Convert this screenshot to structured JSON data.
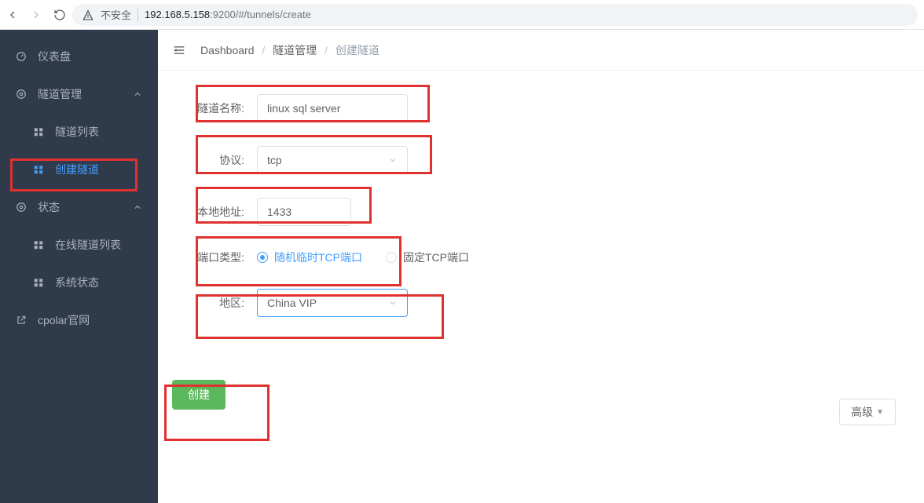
{
  "browser": {
    "secure_label": "不安全",
    "host": "192.168.5.158",
    "port": ":9200",
    "path": "/#/tunnels/create"
  },
  "sidebar": {
    "dashboard": "仪表盘",
    "tunnel_mgmt": "隧道管理",
    "tunnel_list": "隧道列表",
    "tunnel_create": "创建隧道",
    "status": "状态",
    "online_list": "在线隧道列表",
    "sys_status": "系统状态",
    "official": "cpolar官网"
  },
  "breadcrumb": {
    "a": "Dashboard",
    "b": "隧道管理",
    "c": "创建隧道"
  },
  "form": {
    "name_label": "隧道名称:",
    "name_value": "linux sql server",
    "protocol_label": "协议:",
    "protocol_value": "tcp",
    "local_addr_label": "本地地址:",
    "local_addr_value": "1433",
    "port_type_label": "端口类型:",
    "port_type_random": "随机临时TCP端口",
    "port_type_fixed": "固定TCP端口",
    "region_label": "地区:",
    "region_value": "China VIP",
    "advanced": "高级",
    "create": "创建"
  }
}
